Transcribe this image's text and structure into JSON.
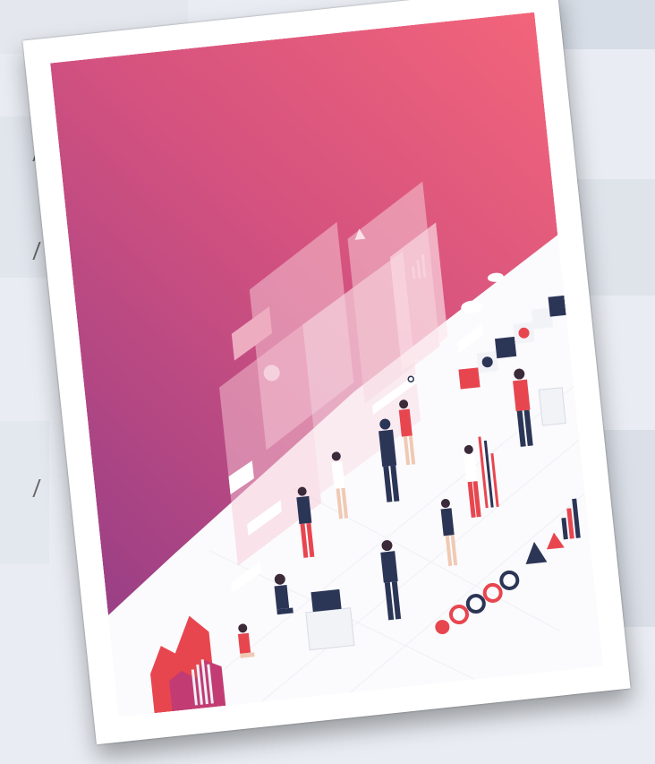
{
  "scene": {
    "subject": "isometric-data-analytics-illustration",
    "colors": {
      "background": "#e9edf3",
      "frame": "#ffffff",
      "gradient_left": "#b44a86",
      "gradient_right": "#f0607a",
      "accent_red": "#e8464f",
      "navy": "#2b3556",
      "light_panel": "#f4dfe6"
    }
  }
}
